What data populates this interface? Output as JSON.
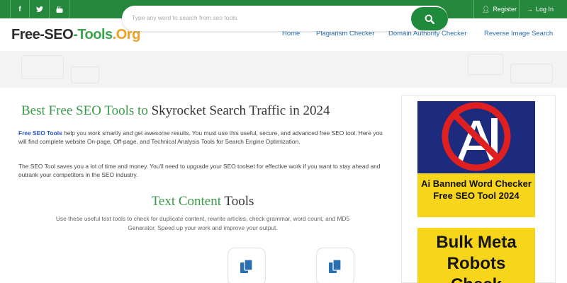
{
  "topbar": {
    "social": [
      "facebook-icon",
      "twitter-icon",
      "youtube-icon"
    ],
    "register_label": "Register",
    "login_label": "Log In"
  },
  "nav": {
    "logo": {
      "part1": "Free-",
      "part2": "SEO",
      "part3": "-Tools",
      "part4": ".Org"
    },
    "links": [
      "Home",
      "Plagiarism Checker",
      "Domain Authority Checker",
      "Reverse Image Search"
    ]
  },
  "search": {
    "placeholder": "Type any word to search from seo tools"
  },
  "main": {
    "headline_green": "Best Free SEO Tools to",
    "headline_dark": " Skyrocket Search Traffic in 2024",
    "para1_link": "Free SEO Tools",
    "para1_rest": " help you work smartly and get awesome results. You must use this useful, secure, and advanced free SEO tool. Here you will find complete website On-page, Off-page, and Technical Analysis Tools for Search Engine Optimization.",
    "para2": "The SEO Tool saves you a lot of time and money. You'll need to upgrade your SEO toolset for effective work if you want to stay ahead and outrank your competitors in the SEO industry.",
    "section_title_green": "Text Content",
    "section_title_dark": " Tools",
    "section_desc": "Use these useful text tools to check for duplicate content, rewrite articles, check grammar, word count, and MD5 Generator. Speed up your work and improve your output."
  },
  "sidebar": {
    "ad1_line1": "Ai Banned Word Checker",
    "ad1_line2": "Free SEO Tool 2024",
    "ad2_line1": "Bulk Meta",
    "ad2_line2": "Robots",
    "ad2_line3": "Check"
  },
  "colors": {
    "brand_green": "#25883c",
    "link_blue": "#2a6fb0",
    "ad_yellow": "#f7d51a",
    "ad_navy": "#1c2b7d"
  }
}
